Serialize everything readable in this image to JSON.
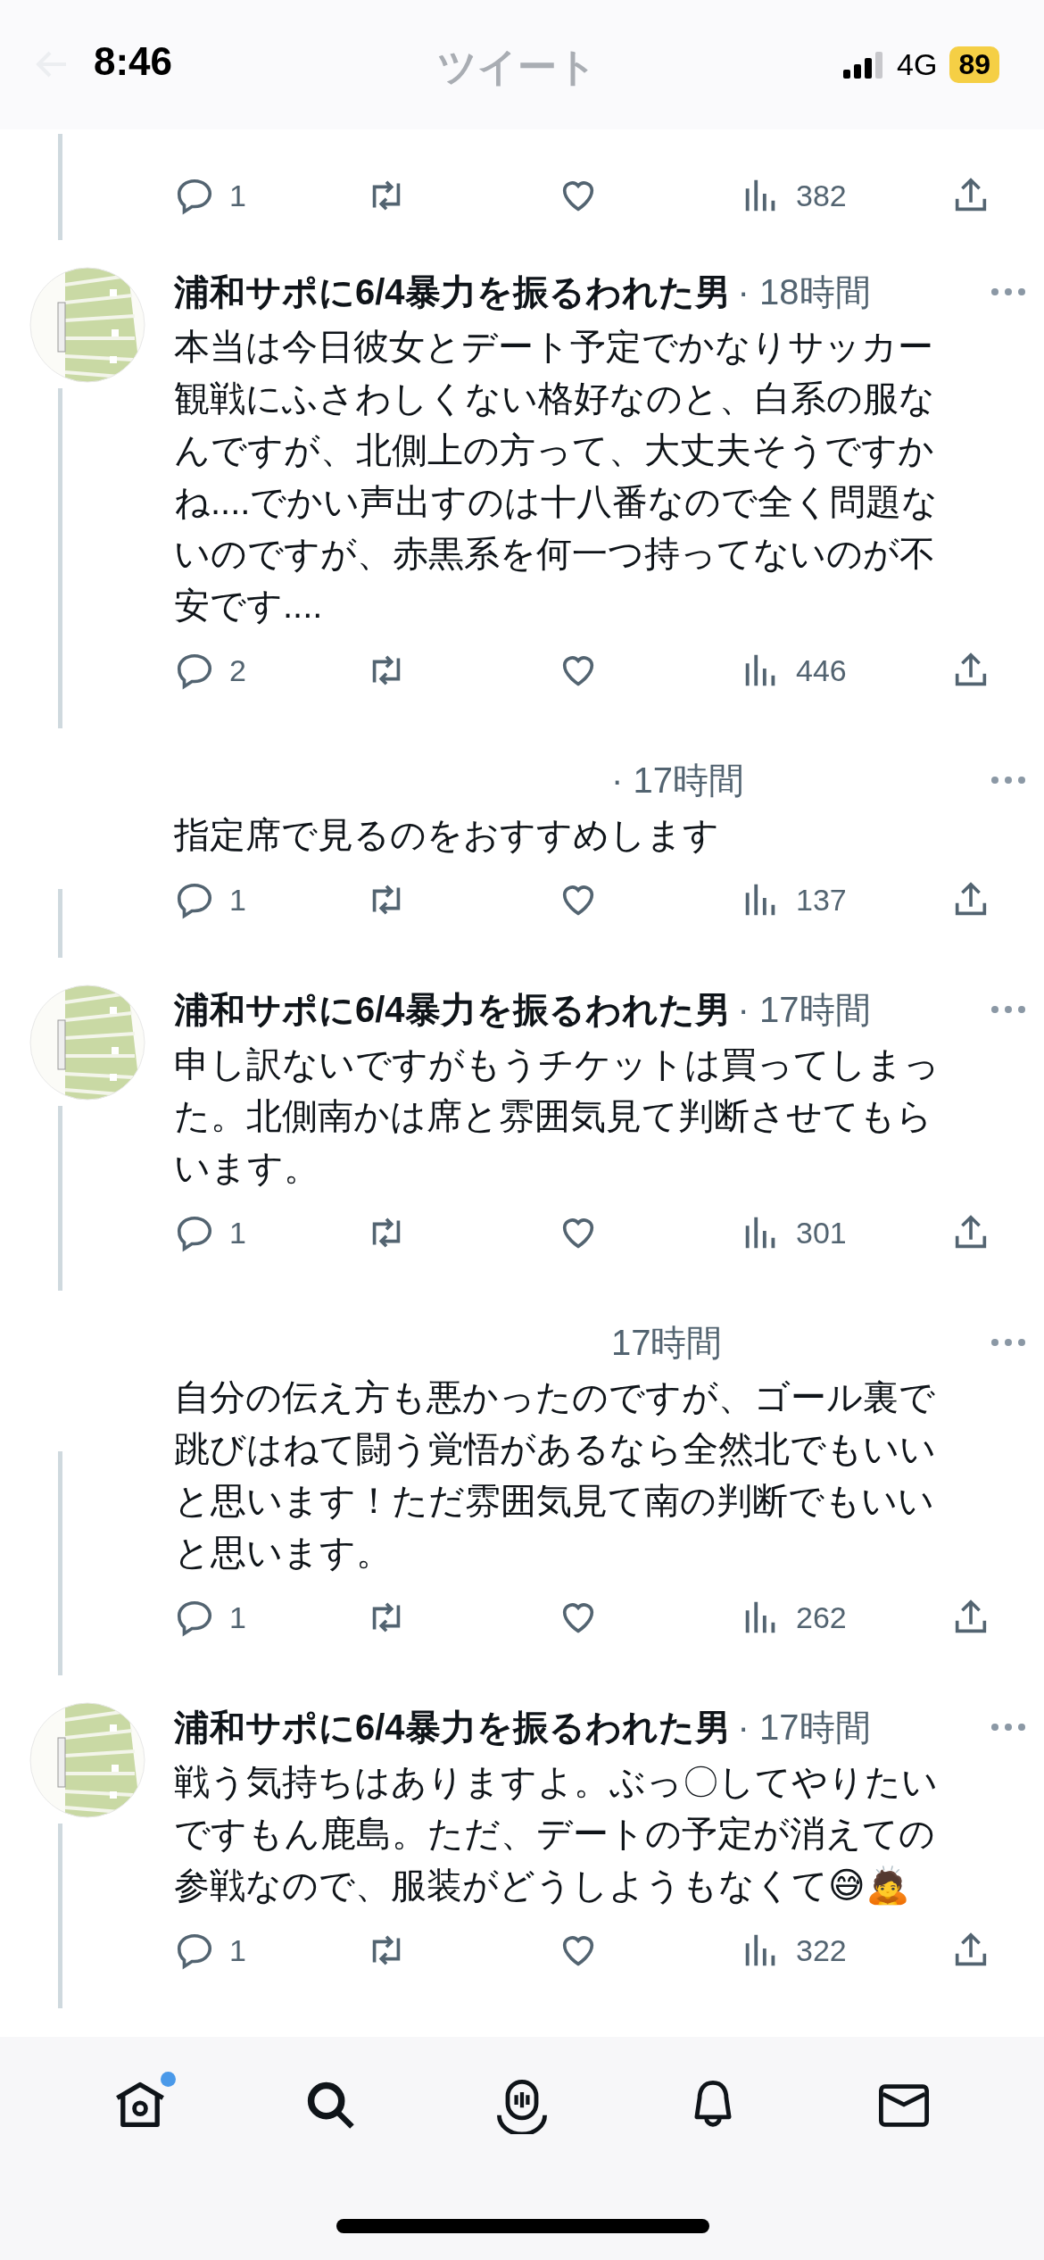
{
  "status_bar": {
    "time": "8:46",
    "network": "4G",
    "battery": "89"
  },
  "header": {
    "title": "ツイート"
  },
  "top_actions": {
    "replies": "1",
    "views": "382"
  },
  "tweets": [
    {
      "kind": "with_author",
      "author": "浦和サポに6/4暴力を振るわれた男",
      "time": "· 18時間",
      "text": "本当は今日彼女とデート予定でかなりサッカー観戦にふさわしくない格好なのと、白系の服なんですが、北側上の方って、大丈夫そうですかね....でかい声出すのは十八番なので全く問題ないのですが、赤黒系を何一つ持ってないのが不安です....",
      "replies": "2",
      "views": "446"
    },
    {
      "kind": "hidden_author",
      "time": "· 17時間",
      "text": "指定席で見るのをおすすめします",
      "replies": "1",
      "views": "137"
    },
    {
      "kind": "with_author",
      "author": "浦和サポに6/4暴力を振るわれた男",
      "time": "· 17時間",
      "text": "申し訳ないですがもうチケットは買ってしまった。北側南かは席と雰囲気見て判断させてもらいます。",
      "replies": "1",
      "views": "301"
    },
    {
      "kind": "hidden_author",
      "time": "17時間",
      "text": "自分の伝え方も悪かったのですが、ゴール裏で跳びはねて闘う覚悟があるなら全然北でもいいと思います！ただ雰囲気見て南の判断でもいいと思います。",
      "replies": "1",
      "views": "262"
    },
    {
      "kind": "with_author",
      "author": "浦和サポに6/4暴力を振るわれた男",
      "time": "· 17時間",
      "text": "戦う気持ちはありますよ。ぶっ〇してやりたいですもん鹿島。ただ、デートの予定が消えての参戦なので、服装がどうしようもなくて😅🙇",
      "replies": "1",
      "views": "322"
    }
  ],
  "tab_bar": [
    {
      "kind": "home",
      "unread": true
    },
    {
      "kind": "search",
      "unread": false
    },
    {
      "kind": "spaces",
      "unread": false
    },
    {
      "kind": "notifications",
      "unread": false
    },
    {
      "kind": "messages",
      "unread": false
    }
  ]
}
